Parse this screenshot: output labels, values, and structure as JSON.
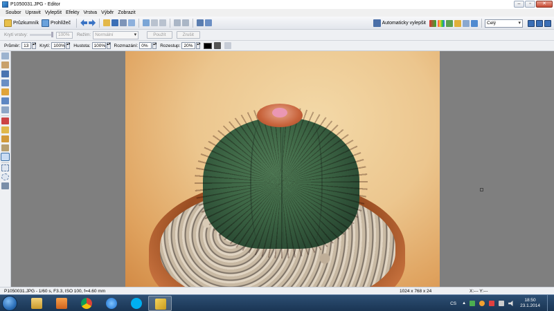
{
  "window": {
    "title": "P1050031.JPG - Editor"
  },
  "menu": [
    "Soubor",
    "Upravit",
    "Vylepšit",
    "Efekty",
    "Vrstva",
    "Výběr",
    "Zobrazit"
  ],
  "toolbar": {
    "explorer_label": "Průzkumník",
    "viewer_label": "Prohlížeč",
    "auto_enhance_label": "Automaticky vylepšit",
    "zoom_value": "Celý"
  },
  "layer_toolbar": {
    "opacity_label": "Krytí vrstvy:",
    "opacity_value": "100%",
    "mode_label": "Režim:",
    "mode_value": "Normální",
    "apply_label": "Použít",
    "cancel_label": "Zrušit"
  },
  "brush_toolbar": {
    "diameter_label": "Průměr:",
    "diameter_value": "13",
    "opacity_label": "Krytí:",
    "opacity_value": "100%",
    "density_label": "Hustota:",
    "density_value": "100%",
    "blur_label": "Rozmazání:",
    "blur_value": "0%",
    "spacing_label": "Rozestup:",
    "spacing_value": "20%"
  },
  "colors": {
    "canvas_bg": "#7f7f7f",
    "brush_color": "#000000",
    "taskbar": "#1f3d60"
  },
  "statusbar": {
    "file_info": "P1050031.JPG - 1/60 s, F3.3, ISO 100, f=4.60 mm",
    "dimensions": "1024 x 768 x 24",
    "coords": "X:---  Y:---"
  },
  "taskbar": {
    "apps": [
      "explorer-icon",
      "media-player-icon",
      "chrome-icon",
      "internet-explorer-icon",
      "skype-icon",
      "zoner-icon"
    ],
    "language": "CS",
    "time": "18:50",
    "date": "23.1.2014"
  }
}
